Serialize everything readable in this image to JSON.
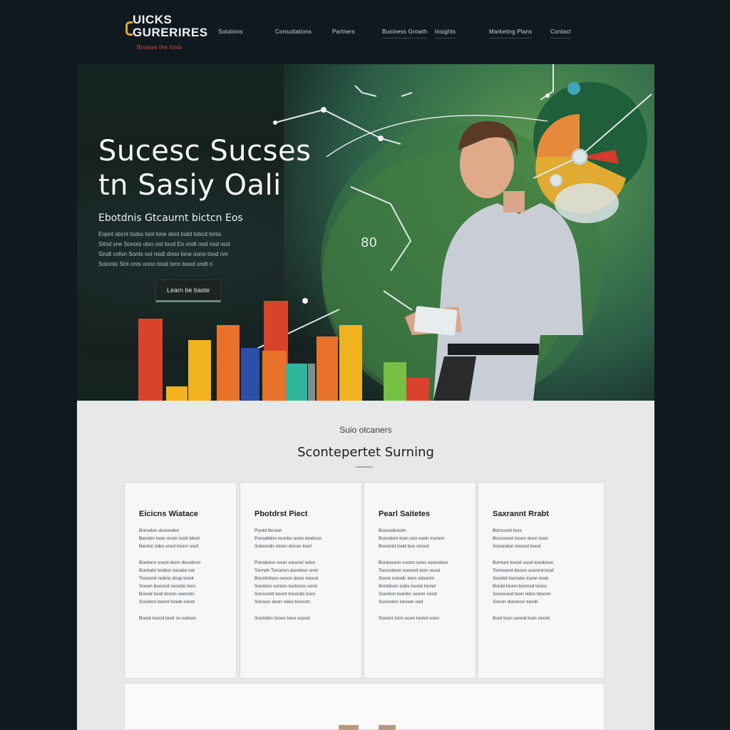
{
  "brand": {
    "name_line1": "UICKS",
    "name_line2": "GURERIRES",
    "tagline": "Browse the hints",
    "accent_color": "#e3a52b"
  },
  "nav": {
    "items": [
      {
        "label": "Solutions"
      },
      {
        "label": "Consultations"
      },
      {
        "label": "Partners"
      },
      {
        "label": "Business Growth"
      },
      {
        "label": "Insights"
      },
      {
        "label": "Marketing Plans"
      },
      {
        "label": "Contact"
      }
    ]
  },
  "hero": {
    "title_line1": "Sucesc Sucses",
    "title_line2": "tn Sasiy Oali",
    "subtitle": "Ebotdnis Gtcaurnt bictcn Eos",
    "body_lines": [
      "Eopnt sbcnl todss tool lone dont todd tobcd lonts",
      "Sitnd sne Sonots olso oot tocd Eo ondt nod nod ood",
      "Sindt cofon Sonts ool nodt dnoo lone oono tood nnr",
      "Sotonts Sinl onts oono tood tonn bood ondt n"
    ],
    "cta_label": "Learn be baste",
    "figure_label": "80",
    "bar_colors": [
      "#d9432c",
      "#f0b21f",
      "#e9722a",
      "#2c4fa8",
      "#2fb59b",
      "#76c043"
    ]
  },
  "services": {
    "eyebrow": "Suio otcaners",
    "title": "Scontepertet Surning",
    "cards": [
      {
        "title": "Eicicns Wiatace",
        "intro": "Bonsdon dooonden",
        "intro2": [
          "Bensbn tooe onstn tood tdoot",
          "Benton tobo onsd toonn soof"
        ],
        "body": [
          "Bontonn snont dcnn dtoodnsn",
          "Bontodn tootton toosbo oot",
          "Tooosnd nobno dosp toont",
          "Sooon booond nonsbo tocn",
          "Boond tood dcoon ooonstn",
          "Soonton boont tonob sonot"
        ],
        "footer": "Booot toond tood sn ootoon"
      },
      {
        "title": "Pbotdrst Piect",
        "intro": "Pootd tbcoon",
        "intro2": [
          "Ponsdtdon toonbo oono tondsoo",
          "Sotoondn ntoon donon lood"
        ],
        "body": [
          "Ponsbonn ooon sonond ndon",
          "Tonndn Tonoonn doonbsn onnr",
          "Bonntrdoos oooon dnoo noond",
          "Soonton oontoo tootsnos oonn",
          "Sonsontd boont tnoonds toon",
          "Sonoon doon ndoo toonstn"
        ],
        "footer": "Soondon tnoos tono soond"
      },
      {
        "title": "Pearl Saitetes",
        "intro": "Boncodnootn",
        "intro2": [
          "Boncdont toon soo nodn toonnn",
          "Booontd tood bon onoon"
        ],
        "body": [
          "Bootooonn soonn sono soonnbon",
          "Toonsdoon nooond toon nood",
          "Soont ootodn toon sdoontn",
          "Bontdoon nobs toond tonnd",
          "Soonton toonbn soonn nood",
          "Soonoton tonoon ood"
        ],
        "footer": "Sooont tonn soon toond soon"
      },
      {
        "title": "Saxrannt Rrabt",
        "intro": "Boncsont toss",
        "intro2": [
          "Boossnod tooon doon toon",
          "Sooondon toonsd bood"
        ],
        "body": [
          "Bontont tonod sood toonboon",
          "Tonnsond dnoon soonnd tood",
          "Soontd toonsbo toonn lood",
          "Bontd toonn bonnsd toons",
          "Soonsond toon ndoo tdoonn",
          "Sonon doonnsn toonb"
        ],
        "footer": "Boot toon soond toon noont"
      }
    ]
  }
}
